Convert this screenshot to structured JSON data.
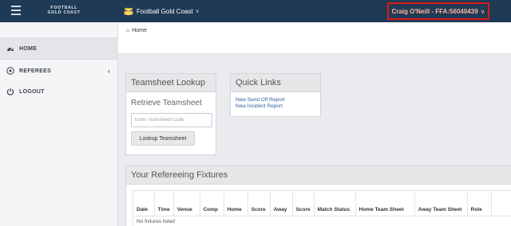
{
  "topbar": {
    "brand_line1": "FOOTBALL",
    "brand_line2": "GOLD COAST",
    "org_name": "Football Gold Coast",
    "org_caret": "∨",
    "user_label": "Craig O'Neill - FFA:56040439",
    "user_caret": "∨"
  },
  "sidebar": {
    "items": [
      {
        "label": "HOME",
        "icon": "dashboard-icon"
      },
      {
        "label": "REFEREES",
        "icon": "football-icon",
        "chevron": "‹"
      },
      {
        "label": "LOGOUT",
        "icon": "power-icon"
      }
    ]
  },
  "breadcrumb": {
    "glyph": "⌂",
    "label": "Home"
  },
  "teamsheet": {
    "title": "Teamsheet Lookup",
    "subtitle": "Retrieve Teamsheet",
    "input_placeholder": "Enter Teamsheet Code",
    "button_label": "Lookup Teamsheet"
  },
  "quick_links": {
    "title": "Quick Links",
    "links": [
      "New Send Off Report",
      "New Incident Report"
    ]
  },
  "fixtures": {
    "title": "Your Refereeing Fixtures",
    "columns": [
      "Date",
      "Time",
      "Venue",
      "Comp",
      "Home",
      "Score",
      "Away",
      "Score",
      "Match Status",
      "Home Team Sheet",
      "Away Team Sheet",
      "Role"
    ],
    "empty_text": "No fixtures listed"
  },
  "colors": {
    "topbar": "#1f3a54",
    "user_highlight_border": "#e01818",
    "link": "#2f5fa5"
  }
}
